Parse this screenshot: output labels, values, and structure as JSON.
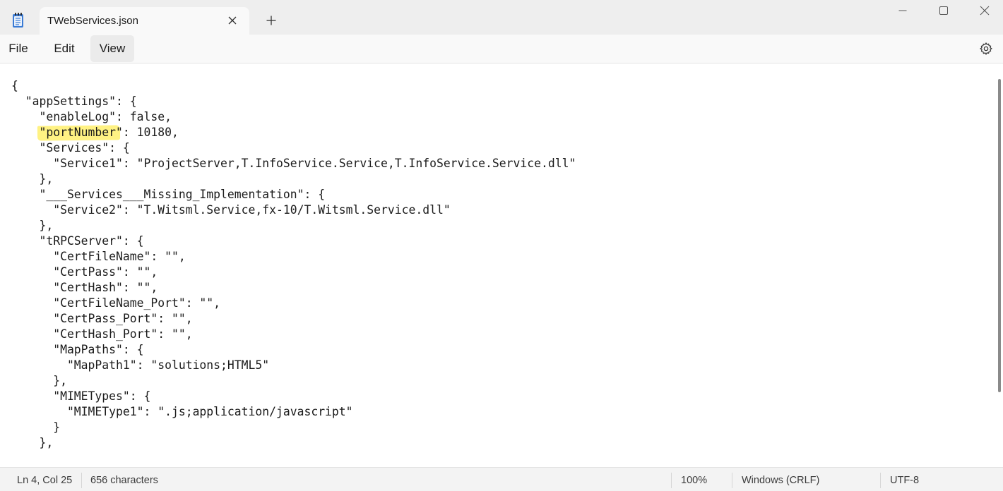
{
  "window": {
    "tab_title": "TWebServices.json",
    "new_tab_symbol": "+",
    "icons": {
      "app": "notepad-icon",
      "close_tab": "close-icon",
      "minimize": "minimize-icon",
      "maximize": "maximize-icon",
      "close_window": "close-icon",
      "settings": "gear-icon"
    }
  },
  "menu": {
    "file": "File",
    "edit": "Edit",
    "view": "View"
  },
  "editor": {
    "lines": [
      "{",
      "  \"appSettings\": {",
      "    \"enableLog\": false,",
      "    \"portNumber\": 10180,",
      "    \"Services\": {",
      "      \"Service1\": \"ProjectServer,T.InfoService.Service,T.InfoService.Service.dll\"",
      "    },",
      "    \"___Services___Missing_Implementation\": {",
      "      \"Service2\": \"T.Witsml.Service,fx-10/T.Witsml.Service.dll\"",
      "    },",
      "    \"tRPCServer\": {",
      "      \"CertFileName\": \"\",",
      "      \"CertPass\": \"\",",
      "      \"CertHash\": \"\",",
      "      \"CertFileName_Port\": \"\",",
      "      \"CertPass_Port\": \"\",",
      "      \"CertHash_Port\": \"\",",
      "      \"MapPaths\": {",
      "        \"MapPath1\": \"solutions;HTML5\"",
      "      },",
      "      \"MIMETypes\": {",
      "        \"MIMEType1\": \".js;application/javascript\"",
      "      }",
      "    },"
    ],
    "highlight_color": "#fff176"
  },
  "status": {
    "position": "Ln 4, Col 25",
    "characters": "656 characters",
    "zoom": "100%",
    "line_ending": "Windows (CRLF)",
    "encoding": "UTF-8"
  }
}
